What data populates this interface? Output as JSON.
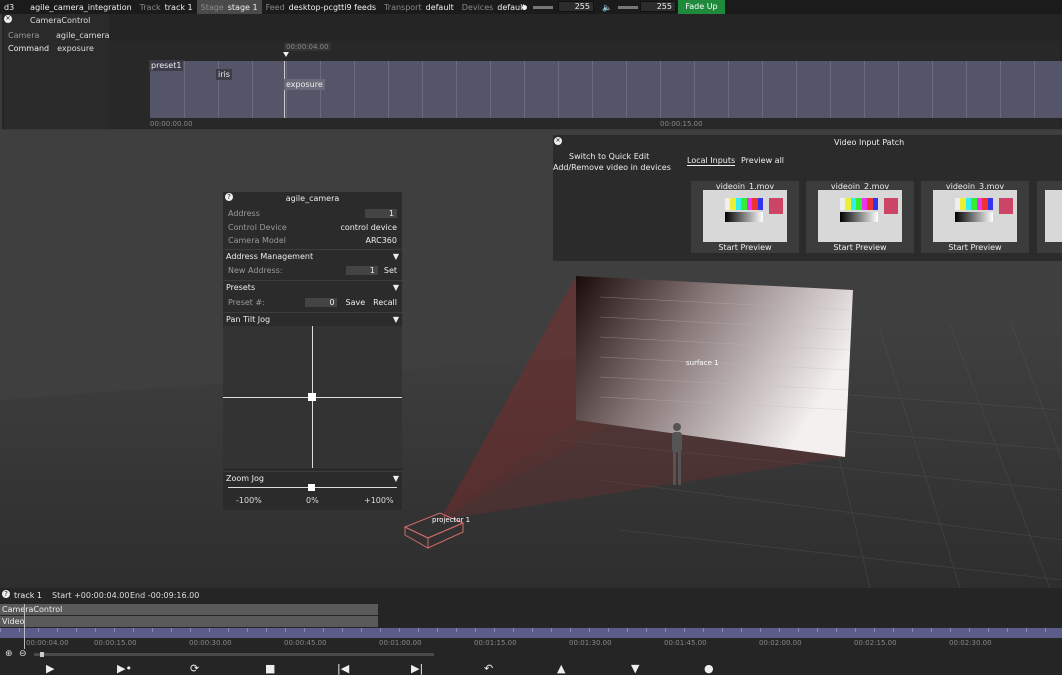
{
  "topbar": {
    "app": "d3",
    "project": "agile_camera_integration",
    "track_label": "Track",
    "track_value": "track 1",
    "stage_label": "Stage",
    "stage_value": "stage 1",
    "feed_label": "Feed",
    "feed_value": "desktop-pcgtti9 feeds",
    "transport_label": "Transport",
    "transport_value": "default",
    "devices_label": "Devices",
    "devices_value": "default",
    "brightness_value": "255",
    "volume_value": "255",
    "fade_up": "Fade Up"
  },
  "camera_control": {
    "title": "CameraControl",
    "camera_label": "Camera",
    "camera_value": "agile_camera",
    "command_label": "Command",
    "command_value": "exposure",
    "keys": {
      "preset": "preset1",
      "iris": "iris",
      "exposure": "exposure"
    },
    "cursor_time": "00:00:04.00",
    "time_start": "00:00:00.00",
    "time_mid": "00:00:15.00"
  },
  "agile_panel": {
    "title": "agile_camera",
    "address_label": "Address",
    "address_value": "1",
    "control_device_label": "Control Device",
    "control_device_value": "control device",
    "camera_model_label": "Camera Model",
    "camera_model_value": "ARC360",
    "address_mgmt": "Address Management",
    "new_address_label": "New Address:",
    "new_address_value": "1",
    "set": "Set",
    "presets": "Presets",
    "preset_label": "Preset #:",
    "preset_value": "0",
    "save": "Save",
    "recall": "Recall",
    "pan_tilt": "Pan Tilt Jog",
    "zoom_jog": "Zoom Jog",
    "zoom_min": "-100%",
    "zoom_mid": "0%",
    "zoom_max": "+100%"
  },
  "video_patch": {
    "title": "Video Input Patch",
    "switch_quick": "Switch to Quick Edit",
    "add_remove": "Add/Remove video in devices",
    "tab_local": "Local Inputs",
    "tab_preview": "Preview all",
    "cards": [
      {
        "name": "videoin_1.mov",
        "action": "Start Preview"
      },
      {
        "name": "videoin_2.mov",
        "action": "Start Preview"
      },
      {
        "name": "videoin_3.mov",
        "action": "Start Preview"
      }
    ]
  },
  "scene": {
    "surface": "surface 1",
    "projector": "projector 1"
  },
  "bottom": {
    "track": "track 1",
    "start": "Start +00:00:04.00",
    "end": "End -00:09:16.00",
    "layer1": "CameraControl",
    "layer2": "Video",
    "ruler_ticks": [
      "00:00:04.00",
      "00:00:15.00",
      "00:00:30.00",
      "00:00:45.00",
      "00:01:00.00",
      "00:01:15.00",
      "00:01:30.00",
      "00:01:45.00",
      "00:02:00.00",
      "00:02:15.00",
      "00:02:30.00"
    ]
  }
}
